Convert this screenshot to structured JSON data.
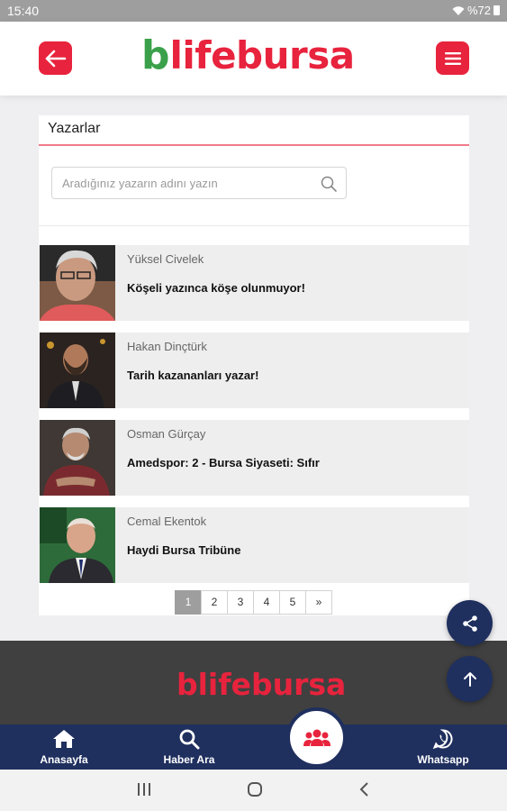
{
  "status_bar": {
    "time": "15:40",
    "battery": "%72"
  },
  "header": {
    "logo_b": "b",
    "logo_text": "lifebursa",
    "back_icon": "arrow-left-icon",
    "menu_icon": "hamburger-menu-icon"
  },
  "page": {
    "title": "Yazarlar",
    "search": {
      "placeholder": "Aradığınız yazarın adını yazın",
      "value": ""
    },
    "authors": [
      {
        "name": "Yüksel Civelek",
        "title": "Köşeli yazınca köşe olunmuyor!"
      },
      {
        "name": "Hakan Dinçtürk",
        "title": "Tarih kazananları yazar!"
      },
      {
        "name": "Osman Gürçay",
        "title": "Amedspor: 2  -  Bursa Siyaseti: Sıfır"
      },
      {
        "name": "Cemal Ekentok",
        "title": "Haydi Bursa Tribüne"
      }
    ],
    "pagination": [
      "1",
      "2",
      "3",
      "4",
      "5",
      "»"
    ],
    "active_page": "1"
  },
  "footer": {
    "logo_b": "b",
    "logo_text": "lifebursa"
  },
  "bottom_nav": {
    "home": "Anasayfa",
    "search": "Haber Ara",
    "whatsapp": "Whatsapp",
    "center_icon": "users-group-icon"
  },
  "colors": {
    "brand_red": "#e8233d",
    "brand_green": "#3aa14a",
    "navy": "#1f2f5e",
    "footer_gray": "#404040"
  }
}
